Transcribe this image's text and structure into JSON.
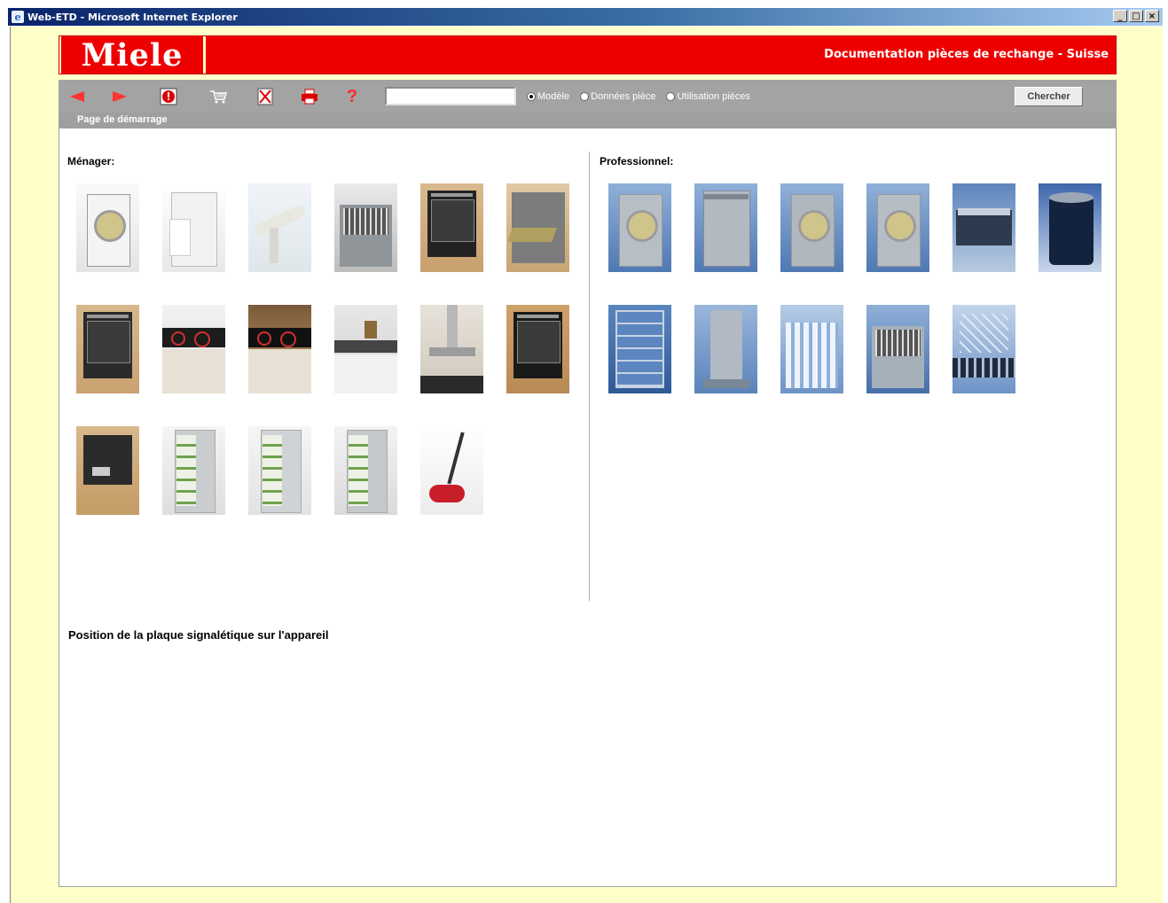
{
  "window": {
    "title": "Web-ETD - Microsoft Internet Explorer",
    "buttons": [
      "_",
      "□",
      "×"
    ]
  },
  "header": {
    "logo": "Miele",
    "title": "Documentation pièces de rechange - Suisse"
  },
  "toolbar": {
    "icons": [
      "back-icon",
      "forward-icon",
      "stop-info-icon",
      "cart-icon",
      "delete-icon",
      "print-icon",
      "help-icon"
    ],
    "search_value": "",
    "radios": [
      {
        "label": "Modèle",
        "checked": true
      },
      {
        "label": "Données pièce",
        "checked": false
      },
      {
        "label": "Utilisation pièces",
        "checked": false
      }
    ],
    "search_label": "Chercher"
  },
  "breadcrumb": "Page de démarrage",
  "menager": {
    "title": "Ménager:",
    "items": [
      "washing-machine-image",
      "dryer-image",
      "rotary-iron-image",
      "dishwasher-image",
      "oven-image",
      "steam-oven-image",
      "microwave-image",
      "hob-image",
      "ceramic-hob-image",
      "kitchen-image",
      "hood-image",
      "built-in-oven-image",
      "coffee-machine-image",
      "fridge-image",
      "freezer-image",
      "fridge-freezer-image",
      "vacuum-cleaner-image"
    ]
  },
  "professionnel": {
    "title": "Professionnel:",
    "items": [
      "pro-washer-image",
      "pro-dryer-image",
      "pro-washer-2-image",
      "pro-washer-3-image",
      "pro-ironer-image",
      "pro-drum-image",
      "pro-rack-image",
      "pro-dishwasher-image",
      "pro-glasswasher-image",
      "pro-lab-washer-image",
      "pro-bottles-image"
    ]
  },
  "footer_link": "Position de la plaque signalétique sur l'appareil"
}
